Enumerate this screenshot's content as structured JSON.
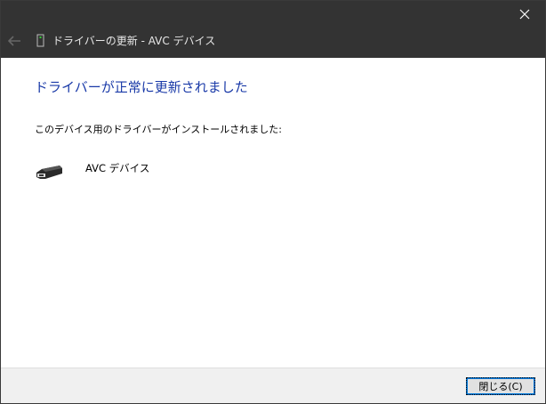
{
  "window": {
    "title": "ドライバーの更新 - AVC デバイス"
  },
  "main": {
    "heading": "ドライバーが正常に更新されました",
    "message": "このデバイス用のドライバーがインストールされました:",
    "device_name": "AVC デバイス"
  },
  "footer": {
    "close_label": "閉じる(C)"
  },
  "colors": {
    "titlebar": "#333333",
    "heading": "#1a3aa8",
    "focus": "#0078d7"
  }
}
